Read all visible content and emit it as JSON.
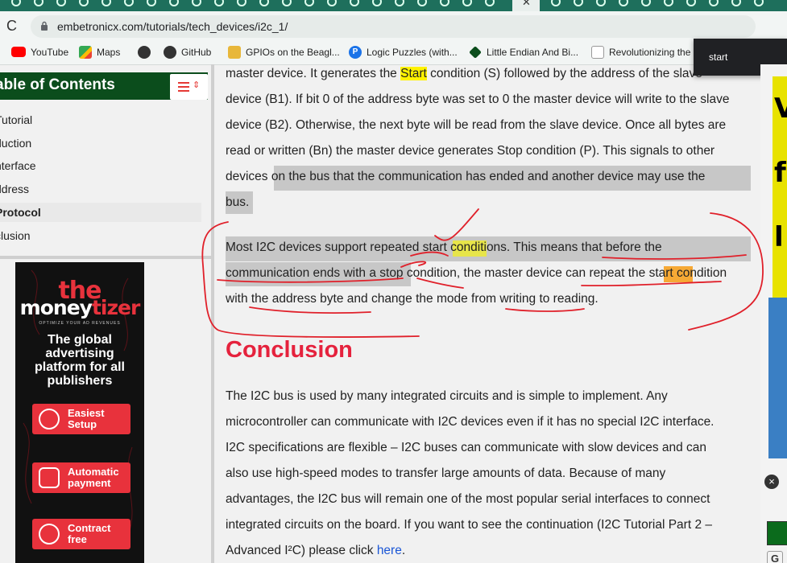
{
  "browser": {
    "active_tab_close": "✕",
    "url": "embetronicx.com/tutorials/tech_devices/i2c_1/",
    "reload_glyph": "C"
  },
  "bookmarks": [
    {
      "label": "YouTube",
      "icon": "youtube-icon",
      "color": "#ff0000"
    },
    {
      "label": "Maps",
      "icon": "maps-icon",
      "color": "#34a853"
    },
    {
      "label": "",
      "icon": "github-icon",
      "color": "#222222"
    },
    {
      "label": "GitHub",
      "icon": "github-icon",
      "color": "#222222"
    },
    {
      "label": "GPIOs on the Beagl...",
      "icon": "folder-icon",
      "color": "#e8b73a"
    },
    {
      "label": "Logic Puzzles (with...",
      "icon": "p-icon",
      "color": "#1a73e8"
    },
    {
      "label": "Little Endian And Bi...",
      "icon": "diamond-icon",
      "color": "#0b4d1c"
    },
    {
      "label": "Revolutionizing the",
      "icon": "site-icon",
      "color": "#555555"
    }
  ],
  "find_popup": {
    "text": "start"
  },
  "toc": {
    "title": "able of Contents",
    "items": [
      "Tutorial",
      "duction",
      "nterface",
      "ddress",
      "Protocol",
      "clusion"
    ],
    "active_index": 4
  },
  "ad": {
    "logo_top": "the",
    "logo_main_a": "money",
    "logo_main_b": "tizer",
    "tagline": "OPTIMIZE YOUR AD REVENUES",
    "headline": "The global advertising platform for all publishers",
    "buttons": [
      "Easiest Setup",
      "Automatic payment",
      "Contract free"
    ]
  },
  "article": {
    "p1": [
      [
        "master device. It generates the ",
        {
          "hl": "Start"
        },
        " condition (S) followed by the address of the slave"
      ],
      [
        "device (B1). If bit 0 of the address byte was set to 0 the master device will write to the slave"
      ],
      [
        "device (B2). Otherwise, the next byte will be read from the slave device. Once all bytes are"
      ],
      [
        "read or written (Bn) the master device generates Stop condition (P). This signals to other"
      ],
      [
        "devices on the bus that the communication has ended and another device may use the"
      ],
      [
        "bus."
      ]
    ],
    "p2_lines": [
      "Most I2C devices support repeated start conditions. This means that before the",
      "communication ends with a stop condition, the master device can repeat the start condition",
      "with the address byte and change the mode from writing to reading."
    ],
    "conclusion_heading": "Conclusion",
    "p3_lines": [
      "The I2C bus is used by many integrated circuits and is simple to implement. Any",
      "microcontroller can communicate with I2C devices even if it has no special I2C interface.",
      "I2C specifications are flexible – I2C buses can communicate with slow devices and can",
      "also use high-speed modes to transfer large amounts of data. Because of many",
      "advantages, the I2C bus will remain one of the most popular serial interfaces to connect",
      "integrated circuits on the board. If you want to see the continuation (I2C Tutorial Part 2 –",
      "Advanced I²C) please click "
    ],
    "here_link": "here",
    "trailing_period": "."
  },
  "colors": {
    "heading": "#e5223d",
    "toc_header": "#0b4d1c",
    "highlight_yellow": "#fff200",
    "highlight_orange": "#f6a935",
    "ink": "#e0202a"
  }
}
